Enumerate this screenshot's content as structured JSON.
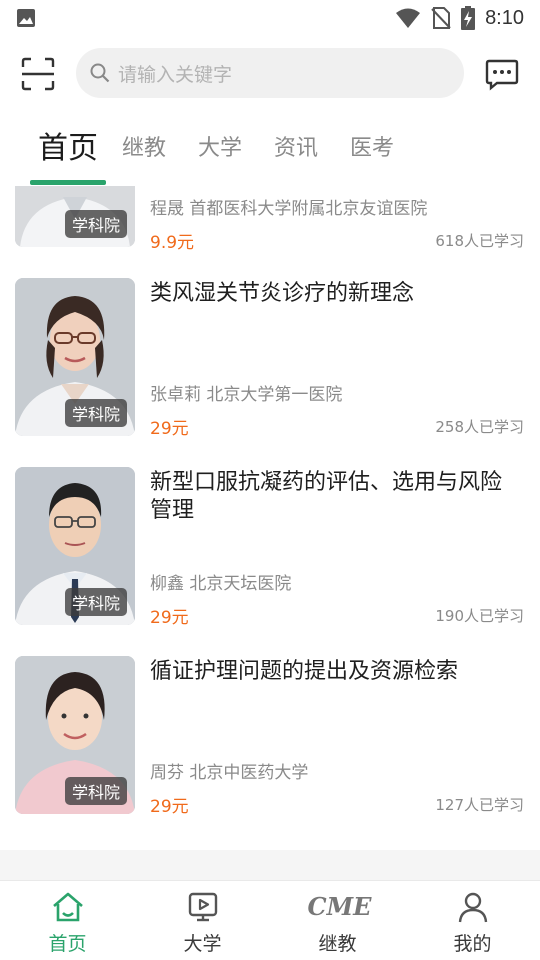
{
  "status_bar": {
    "time": "8:10",
    "icons": [
      "gallery-icon",
      "wifi-icon",
      "no-sim-icon",
      "battery-charging-icon"
    ]
  },
  "search": {
    "placeholder": "请输入关键字",
    "icons": [
      "scan-icon",
      "search-icon",
      "message-icon"
    ]
  },
  "tabs": [
    {
      "label": "首页",
      "active": true
    },
    {
      "label": "继教",
      "active": false
    },
    {
      "label": "大学",
      "active": false
    },
    {
      "label": "资讯",
      "active": false
    },
    {
      "label": "医考",
      "active": false
    }
  ],
  "accent_color": "#2aa36b",
  "price_color": "#f06a1b",
  "courses": [
    {
      "title": "",
      "author": "程晟 首都医科大学附属北京友谊医院",
      "price": "9.9元",
      "learners": "618人已学习",
      "badge": "学科院"
    },
    {
      "title": "类风湿关节炎诊疗的新理念",
      "author": "张卓莉 北京大学第一医院",
      "price": "29元",
      "learners": "258人已学习",
      "badge": "学科院"
    },
    {
      "title": "新型口服抗凝药的评估、选用与风险管理",
      "author": "柳鑫 北京天坛医院",
      "price": "29元",
      "learners": "190人已学习",
      "badge": "学科院"
    },
    {
      "title": "循证护理问题的提出及资源检索",
      "author": "周芬 北京中医药大学",
      "price": "29元",
      "learners": "127人已学习",
      "badge": "学科院"
    }
  ],
  "bottom_nav": [
    {
      "label": "首页",
      "icon": "home-icon",
      "active": true
    },
    {
      "label": "大学",
      "icon": "play-tv-icon",
      "active": false
    },
    {
      "label": "继教",
      "icon": "cme-icon",
      "icon_text": "CME",
      "active": false
    },
    {
      "label": "我的",
      "icon": "person-icon",
      "active": false
    }
  ]
}
